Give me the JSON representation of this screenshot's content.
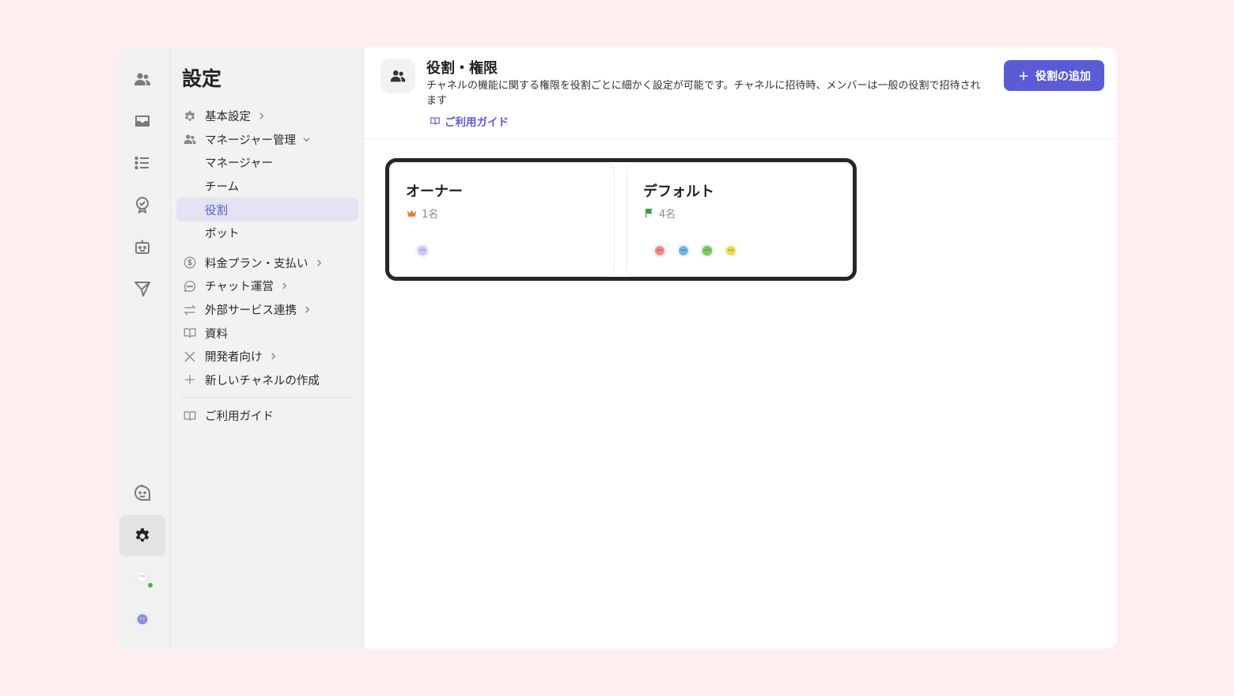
{
  "sidebar": {
    "title": "設定",
    "items": [
      {
        "label": "基本設定",
        "icon": "gear-icon",
        "chevron": "right"
      },
      {
        "label": "マネージャー管理",
        "icon": "users-icon",
        "chevron": "down"
      },
      {
        "label": "マネージャー",
        "sub": true
      },
      {
        "label": "チーム",
        "sub": true
      },
      {
        "label": "役割",
        "sub": true,
        "selected": true
      },
      {
        "label": "ボット",
        "sub": true
      },
      {
        "label": "料金プラン・支払い",
        "icon": "dollar-icon",
        "chevron": "right"
      },
      {
        "label": "チャット運営",
        "icon": "chat-bubble-icon",
        "chevron": "right"
      },
      {
        "label": "外部サービス連携",
        "icon": "arrows-swap-icon",
        "chevron": "right"
      },
      {
        "label": "資料",
        "icon": "book-icon"
      },
      {
        "label": "開発者向け",
        "icon": "tools-icon",
        "chevron": "right"
      },
      {
        "label": "新しいチャネルの作成",
        "icon": "plus-icon"
      }
    ],
    "footer_guide": "ご利用ガイド"
  },
  "header": {
    "title": "役割・権限",
    "description": "チャネルの機能に関する権限を役割ごとに細かく設定が可能です。チャネルに招待時、メンバーは一般の役割で招待されます",
    "guide_link": "ご利用ガイド",
    "add_button": "役割の追加"
  },
  "roles": [
    {
      "name": "オーナー",
      "count": "1名",
      "badge_icon": "crown-icon",
      "badge_color": "#e0862f",
      "avatars": [
        "#c9c9ef"
      ]
    },
    {
      "name": "デフォルト",
      "count": "4名",
      "badge_icon": "flag-icon",
      "badge_color": "#3a9a4a",
      "avatars": [
        "#ef8a8a",
        "#6fb8e8",
        "#7cc86a",
        "#ecd75a"
      ]
    }
  ],
  "colors": {
    "accent": "#5b5bd6",
    "background": "#ffeef0"
  }
}
